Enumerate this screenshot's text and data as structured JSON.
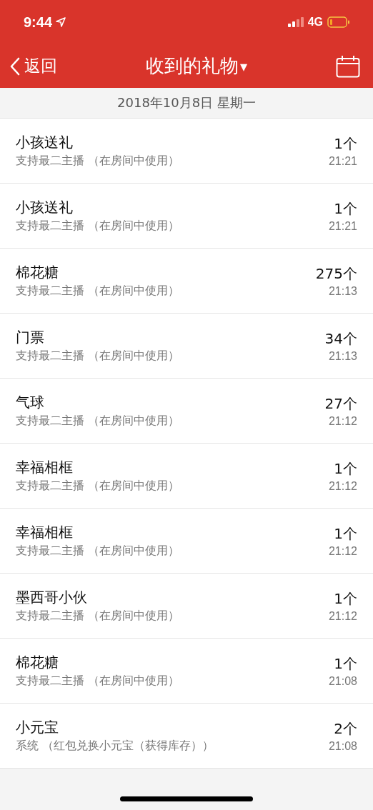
{
  "status_bar": {
    "time": "9:44",
    "network": "4G"
  },
  "nav": {
    "back": "返回",
    "title": "收到的礼物",
    "title_caret": "▾"
  },
  "date_header": "2018年10月8日 星期一",
  "gifts": [
    {
      "name": "小孩送礼",
      "source": "支持最二主播 （在房间中使用）",
      "count": "1个",
      "time": "21:21"
    },
    {
      "name": "小孩送礼",
      "source": "支持最二主播 （在房间中使用）",
      "count": "1个",
      "time": "21:21"
    },
    {
      "name": "棉花糖",
      "source": "支持最二主播 （在房间中使用）",
      "count": "275个",
      "time": "21:13"
    },
    {
      "name": "门票",
      "source": "支持最二主播 （在房间中使用）",
      "count": "34个",
      "time": "21:13"
    },
    {
      "name": "气球",
      "source": "支持最二主播 （在房间中使用）",
      "count": "27个",
      "time": "21:12"
    },
    {
      "name": "幸福相框",
      "source": "支持最二主播 （在房间中使用）",
      "count": "1个",
      "time": "21:12"
    },
    {
      "name": "幸福相框",
      "source": "支持最二主播 （在房间中使用）",
      "count": "1个",
      "time": "21:12"
    },
    {
      "name": "墨西哥小伙",
      "source": "支持最二主播 （在房间中使用）",
      "count": "1个",
      "time": "21:12"
    },
    {
      "name": "棉花糖",
      "source": "支持最二主播 （在房间中使用）",
      "count": "1个",
      "time": "21:08"
    },
    {
      "name": "小元宝",
      "source": "系统 （红包兑换小元宝（获得库存））",
      "count": "2个",
      "time": "21:08"
    }
  ]
}
